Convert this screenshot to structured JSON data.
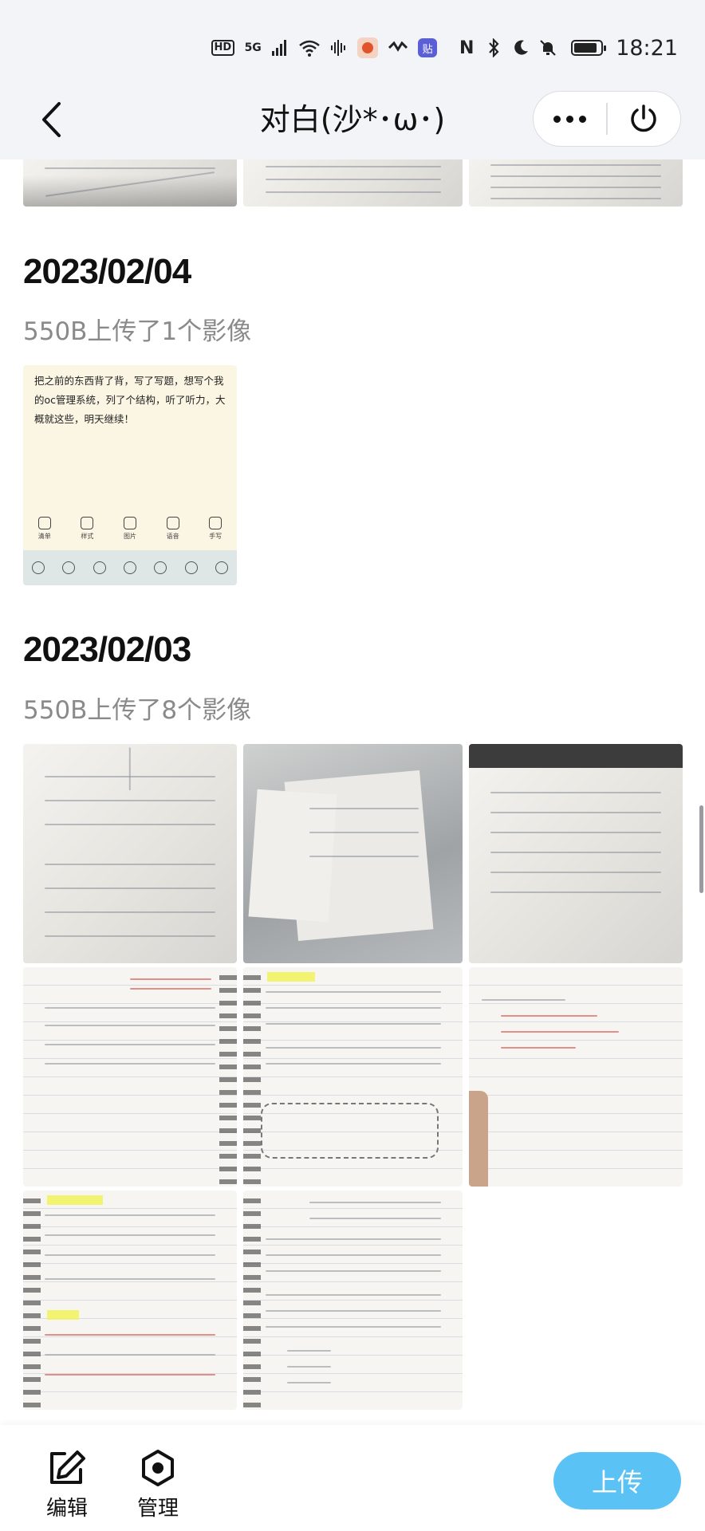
{
  "status_bar": {
    "hd": "HD",
    "net": "5G",
    "nfc": "N",
    "app_badge": "贴",
    "time": "18:21"
  },
  "nav": {
    "title": "对白(沙*･ω･)"
  },
  "sections": [
    {
      "date": "2023/02/04",
      "info": "550B上传了1个影像",
      "screenshot_text": "把之前的东西背了背，写了写题，想写个我的oc管理系统，列了个结构，听了听力，大概就这些，明天继续！",
      "screenshot_tools": [
        "清单",
        "样式",
        "图片",
        "语音",
        "手写"
      ]
    },
    {
      "date": "2023/02/03",
      "info": "550B上传了8个影像"
    }
  ],
  "bottom_bar": {
    "edit_label": "编辑",
    "manage_label": "管理",
    "upload_label": "上传"
  }
}
